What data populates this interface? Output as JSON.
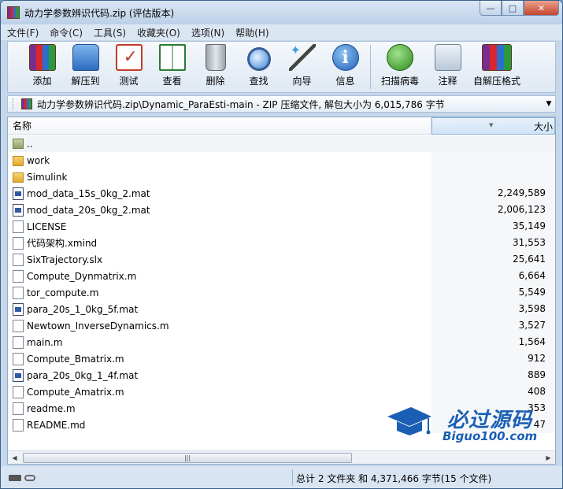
{
  "window": {
    "title": "动力学参数辨识代码.zip (评估版本)",
    "minimize": "—",
    "maximize": "□",
    "close": "✕"
  },
  "menu": [
    {
      "label": "文件(F)"
    },
    {
      "label": "命令(C)"
    },
    {
      "label": "工具(S)"
    },
    {
      "label": "收藏夹(O)"
    },
    {
      "label": "选项(N)"
    },
    {
      "label": "帮助(H)"
    }
  ],
  "toolbar": [
    {
      "label": "添加",
      "icon": "add-icon"
    },
    {
      "label": "解压到",
      "icon": "extract-icon"
    },
    {
      "label": "测试",
      "icon": "test-icon"
    },
    {
      "label": "查看",
      "icon": "view-icon"
    },
    {
      "label": "删除",
      "icon": "delete-icon"
    },
    {
      "label": "查找",
      "icon": "find-icon"
    },
    {
      "label": "向导",
      "icon": "wizard-icon"
    },
    {
      "label": "信息",
      "icon": "info-icon"
    },
    {
      "label": "扫描病毒",
      "icon": "virus-scan-icon"
    },
    {
      "label": "注释",
      "icon": "comment-icon"
    },
    {
      "label": "自解压格式",
      "icon": "sfx-icon"
    }
  ],
  "address": {
    "path": "动力学参数辨识代码.zip\\Dynamic_ParaEsti-main - ZIP 压缩文件, 解包大小为 6,015,786 字节"
  },
  "columns": {
    "name": "名称",
    "size": "大小"
  },
  "files": [
    {
      "name": "..",
      "size": "",
      "type": "up"
    },
    {
      "name": "work",
      "size": "",
      "type": "folder"
    },
    {
      "name": "Simulink",
      "size": "",
      "type": "folder"
    },
    {
      "name": "mod_data_15s_0kg_2.mat",
      "size": "2,249,589",
      "type": "mat"
    },
    {
      "name": "mod_data_20s_0kg_2.mat",
      "size": "2,006,123",
      "type": "mat"
    },
    {
      "name": "LICENSE",
      "size": "35,149",
      "type": "doc"
    },
    {
      "name": "代码架构.xmind",
      "size": "31,553",
      "type": "doc"
    },
    {
      "name": "SixTrajectory.slx",
      "size": "25,641",
      "type": "doc"
    },
    {
      "name": "Compute_Dynmatrix.m",
      "size": "6,664",
      "type": "doc"
    },
    {
      "name": "tor_compute.m",
      "size": "5,549",
      "type": "doc"
    },
    {
      "name": "para_20s_1_0kg_5f.mat",
      "size": "3,598",
      "type": "mat"
    },
    {
      "name": "Newtown_InverseDynamics.m",
      "size": "3,527",
      "type": "doc"
    },
    {
      "name": "main.m",
      "size": "1,564",
      "type": "doc"
    },
    {
      "name": "Compute_Bmatrix.m",
      "size": "912",
      "type": "doc"
    },
    {
      "name": "para_20s_0kg_1_4f.mat",
      "size": "889",
      "type": "mat"
    },
    {
      "name": "Compute_Amatrix.m",
      "size": "408",
      "type": "doc"
    },
    {
      "name": "readme.m",
      "size": "353",
      "type": "doc"
    },
    {
      "name": "README.md",
      "size": "47",
      "type": "doc"
    }
  ],
  "scrollbar": {
    "left": "◀",
    "right": "▶",
    "grip": "|||"
  },
  "status": {
    "summary": "总计 2 文件夹 和 4,371,466 字节(15 个文件)"
  },
  "watermark": {
    "title": "必过源码",
    "subtitle": "Biguo100.com"
  }
}
